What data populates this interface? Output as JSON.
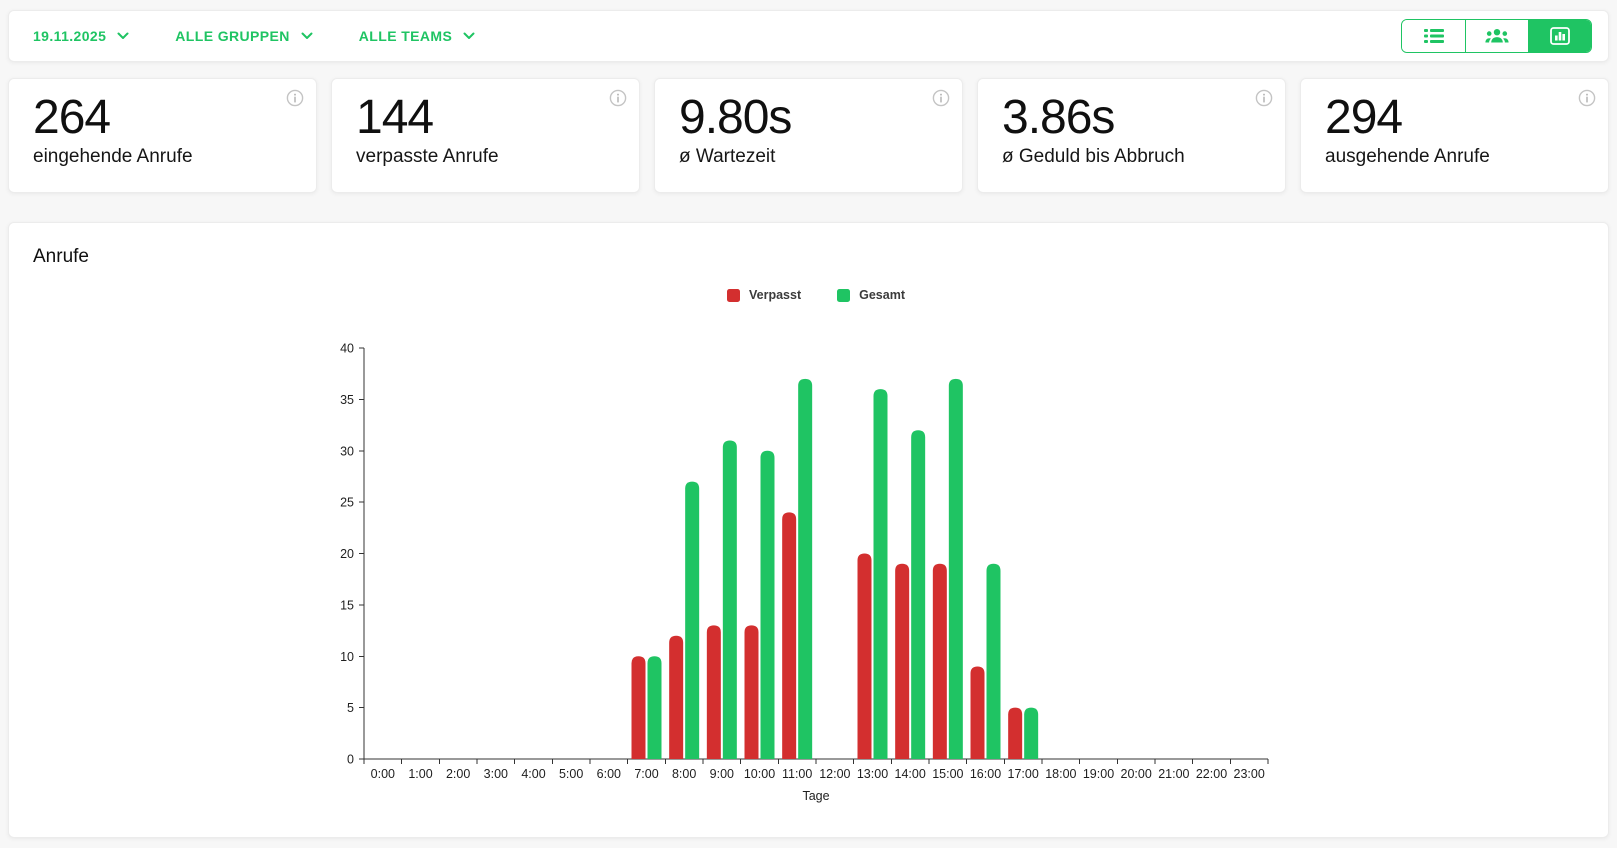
{
  "colors": {
    "brand_green": "#1fc463",
    "bar_red": "#d32f2f",
    "bar_green": "#1fc463",
    "info_gray": "#c4c4c4"
  },
  "topbar": {
    "date_filter": "19.11.2025",
    "groups_filter": "ALLE GRUPPEN",
    "teams_filter": "ALLE TEAMS",
    "view_buttons": [
      {
        "icon": "list-icon",
        "active": false
      },
      {
        "icon": "people-icon",
        "active": false
      },
      {
        "icon": "bar-chart-icon",
        "active": true
      }
    ]
  },
  "stats": [
    {
      "value": "264",
      "label": "eingehende Anrufe"
    },
    {
      "value": "144",
      "label": "verpasste Anrufe"
    },
    {
      "value": "9.80s",
      "label": "ø Wartezeit"
    },
    {
      "value": "3.86s",
      "label": "ø Geduld bis Abbruch"
    },
    {
      "value": "294",
      "label": "ausgehende Anrufe"
    }
  ],
  "chart_card": {
    "title": "Anrufe"
  },
  "chart_data": {
    "type": "bar",
    "title": "Anrufe",
    "categories": [
      "0:00",
      "1:00",
      "2:00",
      "3:00",
      "4:00",
      "5:00",
      "6:00",
      "7:00",
      "8:00",
      "9:00",
      "10:00",
      "11:00",
      "12:00",
      "13:00",
      "14:00",
      "15:00",
      "16:00",
      "17:00",
      "18:00",
      "19:00",
      "20:00",
      "21:00",
      "22:00",
      "23:00"
    ],
    "series": [
      {
        "name": "Verpasst",
        "color": "#d32f2f",
        "values": [
          0,
          0,
          0,
          0,
          0,
          0,
          0,
          10,
          12,
          13,
          13,
          24,
          0,
          20,
          19,
          19,
          9,
          5,
          0,
          0,
          0,
          0,
          0,
          0
        ]
      },
      {
        "name": "Gesamt",
        "color": "#1fc463",
        "values": [
          0,
          0,
          0,
          0,
          0,
          0,
          0,
          10,
          27,
          31,
          30,
          37,
          0,
          36,
          32,
          37,
          19,
          5,
          0,
          0,
          0,
          0,
          0,
          0
        ]
      }
    ],
    "xlabel": "Tage",
    "ylabel": "",
    "ylim": [
      0,
      40
    ],
    "ytick_step": 5,
    "legend_position": "top",
    "grid": false
  }
}
